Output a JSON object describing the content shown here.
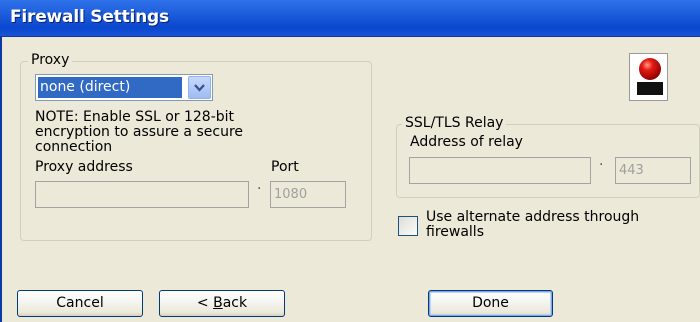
{
  "window": {
    "title": "Firewall Settings"
  },
  "proxy": {
    "group_label": "Proxy",
    "selected_option": "none (direct)",
    "note": [
      "NOTE: Enable SSL or 128-bit",
      "encryption to assure a secure",
      "connection"
    ],
    "address_label": "Proxy address",
    "address_value": "",
    "separator": "·",
    "port_label": "Port",
    "port_value": "1080"
  },
  "relay": {
    "group_label": "SSL/TLS Relay",
    "address_label": "Address of relay",
    "address_value": "",
    "separator": "·",
    "port_value": "443"
  },
  "alternate": {
    "label_lines": [
      "Use alternate address through",
      "firewalls"
    ],
    "checked": false
  },
  "buttons": {
    "cancel": "Cancel",
    "back": "< Back",
    "back_mnemonic": "B",
    "done": "Done"
  },
  "icons": {
    "logo": "red-ball-logo-icon",
    "dropdown": "chevron-down-icon"
  }
}
